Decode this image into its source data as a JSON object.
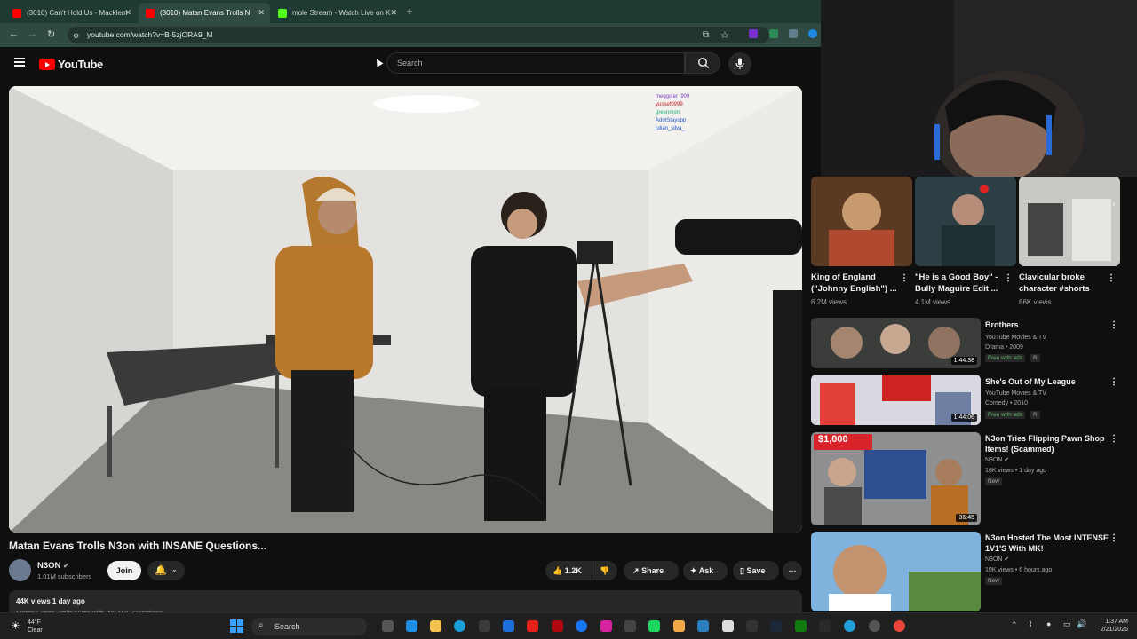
{
  "browser": {
    "tabs": [
      {
        "title": "(3010) Can't Hold Us - Macklem",
        "active": false,
        "icon": "youtube-favicon"
      },
      {
        "title": "(3010) Matan Evans Trolls N",
        "active": true,
        "icon": "youtube-favicon"
      },
      {
        "title": "mole Stream - Watch Live on K",
        "active": false,
        "icon": "kick-favicon"
      }
    ],
    "url": "youtube.com/watch?v=B-5zjORA9_M"
  },
  "youtube": {
    "logo_text": "YouTube",
    "search_placeholder": "Search"
  },
  "video": {
    "title": "Matan Evans Trolls N3on with INSANE Questions...",
    "channel": "N3ON",
    "subscribers": "1.01M subscribers",
    "join_label": "Join",
    "likes": "1.2K",
    "share_label": "Share",
    "ask_label": "Ask",
    "save_label": "Save",
    "views_date": "44K views  1 day ago",
    "description_preview": "Matan Evans Trolls N3on with INSANE Questions...",
    "overlay_chat": [
      "meggster_909",
      "yussef0999",
      "greenmon",
      "AdotStayupp",
      "julian_silva_"
    ]
  },
  "shorts": [
    {
      "title": "King of England (\"Johnny English\") ...",
      "views": "6.2M views"
    },
    {
      "title": "\"He is a Good Boy\" - Bully Maguire Edit ...",
      "views": "4.1M views"
    },
    {
      "title": "Clavicular broke character #shorts",
      "views": "66K views"
    }
  ],
  "recommendations": [
    {
      "title": "Brothers",
      "channel": "YouTube Movies & TV",
      "meta": "Drama • 2009",
      "badge": "Free with ads",
      "rating": "R",
      "duration": "1:44:38"
    },
    {
      "title": "She's Out of My League",
      "channel": "YouTube Movies & TV",
      "meta": "Comedy • 2010",
      "badge": "Free with ads",
      "rating": "R",
      "duration": "1:44:06"
    },
    {
      "title": "N3on Tries Flipping Pawn Shop Items! (Scammed)",
      "channel": "N3ON",
      "meta": "16K views • 1 day ago",
      "badge": "New",
      "duration": "36:45",
      "thumb_text": "$1,000"
    },
    {
      "title": "N3on Hosted The Most INTENSE 1V1'S With MK!",
      "channel": "N3ON",
      "meta": "10K views • 6 hours ago",
      "badge": "New"
    }
  ],
  "taskbar": {
    "weather_temp": "44°F",
    "weather_text": "Clear",
    "search_label": "Search",
    "time": "1:37 AM",
    "date": "2/21/2026"
  },
  "colors": {
    "youtube_red": "#ff0000",
    "browser_frame": "#1f3a33",
    "page_bg": "#0f0f0f",
    "free_badge": "#5fb46c"
  }
}
